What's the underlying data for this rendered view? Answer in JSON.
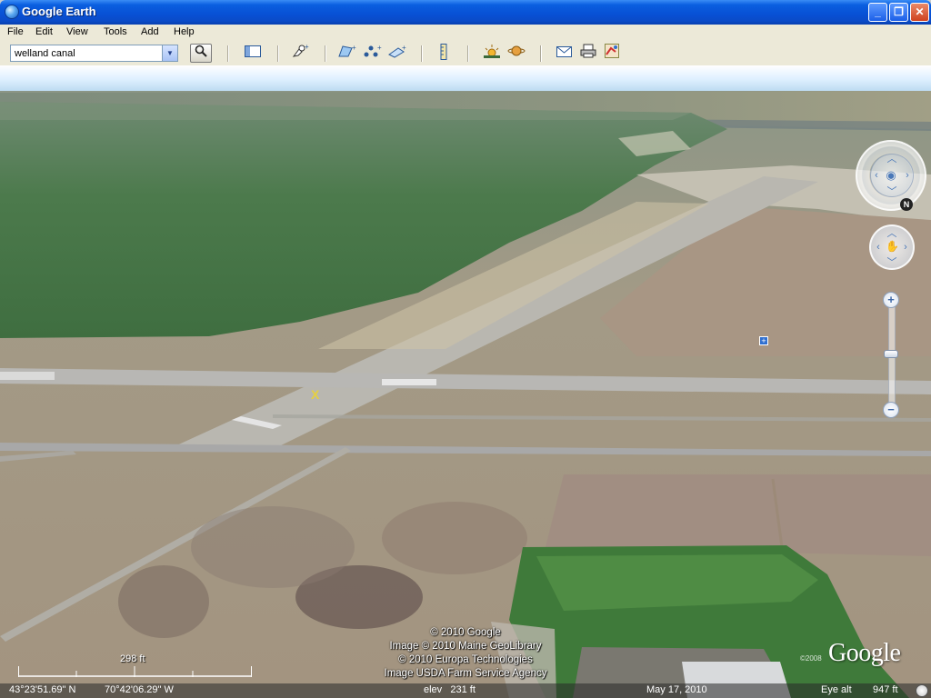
{
  "window": {
    "title": "Google Earth",
    "controls": {
      "minimize": "_",
      "maximize": "❐",
      "close": "✕"
    }
  },
  "menu": [
    "File",
    "Edit",
    "View",
    "Tools",
    "Add",
    "Help"
  ],
  "toolbar": {
    "search_value": "welland canal",
    "icons": [
      "search-icon",
      "sidebar-icon",
      "placemark-icon",
      "polygon-icon",
      "path-icon",
      "image-overlay-icon",
      "ruler-icon",
      "sunlight-icon",
      "planet-icon",
      "email-icon",
      "print-icon",
      "maps-icon"
    ]
  },
  "navigation": {
    "north_label": "N",
    "zoom_in": "+",
    "zoom_out": "−",
    "zoom_level_fraction": 0.5
  },
  "attribution": [
    "© 2010 Google",
    "Image © 2010 Maine GeoLibrary",
    "© 2010 Europa Technologies",
    "Image USDA Farm Service Agency"
  ],
  "logo": {
    "text": "Google",
    "year": "©2008"
  },
  "scale": {
    "label": "298 ft"
  },
  "status": {
    "lat": "43°23'51.69\" N",
    "lon": "70°42'06.29\" W",
    "elev": "elev   231 ft",
    "date": "May 17, 2010",
    "eye_alt_label": "Eye alt",
    "eye_alt_value": "947 ft"
  }
}
